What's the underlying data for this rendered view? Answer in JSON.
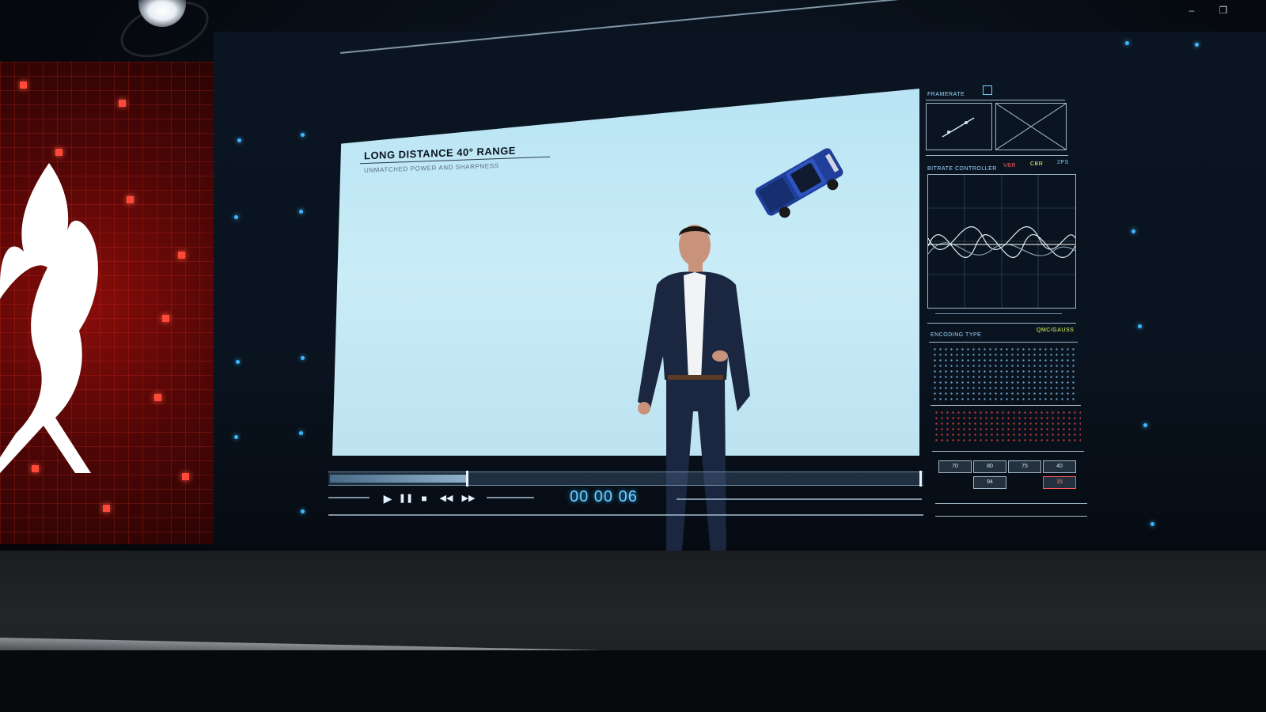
{
  "window": {
    "minimize_glyph": "–",
    "restore_glyph": "❐"
  },
  "slide": {
    "title": "LONG DISTANCE 40° RANGE",
    "subtitle": "UNMATCHED POWER AND SHARPNESS"
  },
  "player": {
    "timecode": "00 00 06",
    "progress": 0.23,
    "play_glyph": "▶",
    "pause_glyph": "❚❚",
    "stop_glyph": "■",
    "rewind_glyph": "◀◀",
    "forward_glyph": "▶▶"
  },
  "panel": {
    "framerate_label": "FRAMERATE",
    "bitrate_label": "BITRATE CONTROLLER",
    "vbr": "VBR",
    "cbr": "CBR",
    "fps": "2PS",
    "encoding_label": "ENCODING TYPE",
    "encoding_value": "QMC/GAUSS",
    "grid_values": [
      "70",
      "80",
      "75",
      "40",
      "94",
      "15"
    ]
  },
  "colors": {
    "accent": "#6fd2ff",
    "screen": "#c3e8f5",
    "brand_red": "#8a0d0a"
  }
}
